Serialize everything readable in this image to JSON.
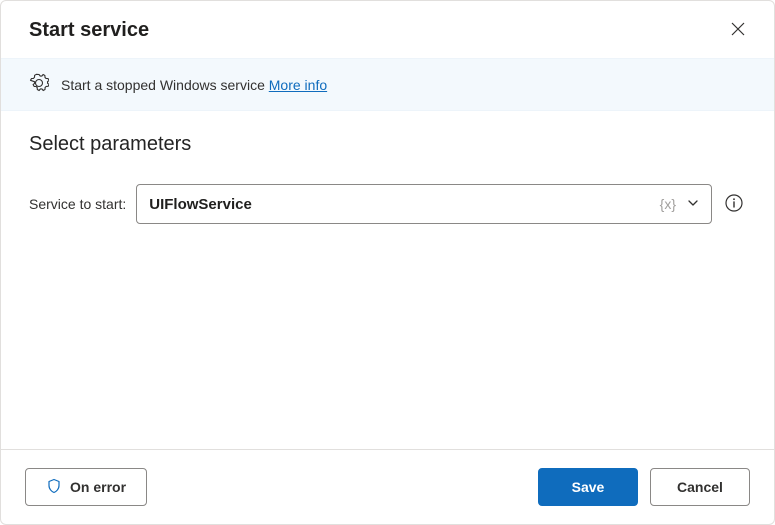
{
  "header": {
    "title": "Start service"
  },
  "banner": {
    "description": "Start a stopped Windows service",
    "more_info_label": "More info"
  },
  "content": {
    "section_title": "Select parameters",
    "service_label": "Service to start:",
    "service_value": "UIFlowService",
    "variable_token": "{x}"
  },
  "footer": {
    "on_error_label": "On error",
    "save_label": "Save",
    "cancel_label": "Cancel"
  }
}
